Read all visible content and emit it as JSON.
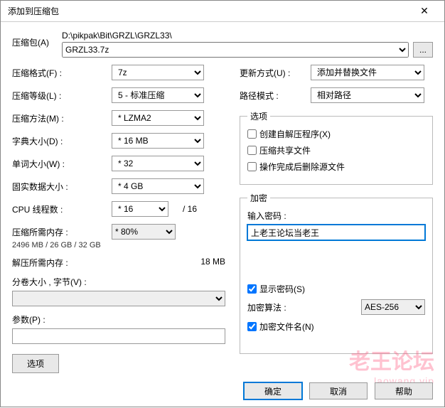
{
  "title": "添加到压缩包",
  "archive": {
    "label": "压缩包(A)",
    "path": "D:\\pikpak\\Bit\\GRZL\\GRZL33\\",
    "name": "GRZL33.7z",
    "browse": "..."
  },
  "left": {
    "format": {
      "label": "压缩格式(F) :",
      "value": "7z"
    },
    "level": {
      "label": "压缩等级(L) :",
      "value": "5 - 标准压缩"
    },
    "method": {
      "label": "压缩方法(M) :",
      "value": "* LZMA2"
    },
    "dict": {
      "label": "字典大小(D) :",
      "value": "* 16 MB"
    },
    "word": {
      "label": "单词大小(W) :",
      "value": "* 32"
    },
    "solid": {
      "label": "固实数据大小 :",
      "value": "* 4 GB"
    },
    "cpu": {
      "label": "CPU 线程数 :",
      "value": "* 16",
      "total": "/ 16"
    },
    "mem_compress": {
      "label": "压缩所需内存 :",
      "value": "* 80%",
      "detail": "2496 MB / 26 GB / 32 GB"
    },
    "mem_decomp": {
      "label": "解压所需内存 :",
      "value": "18 MB"
    },
    "volume": {
      "label": "分卷大小 , 字节(V) :",
      "value": ""
    },
    "params": {
      "label": "参数(P) :",
      "value": ""
    },
    "options_btn": "选项"
  },
  "right": {
    "update": {
      "label": "更新方式(U) :",
      "value": "添加并替换文件"
    },
    "pathmode": {
      "label": "路径模式 :",
      "value": "相对路径"
    },
    "options": {
      "legend": "选项",
      "sfx": "创建自解压程序(X)",
      "shared": "压缩共享文件",
      "delete": "操作完成后删除源文件"
    },
    "encryption": {
      "legend": "加密",
      "pw_label": "输入密码 :",
      "pw_value": "上老王论坛当老王",
      "show_pw": "显示密码(S)",
      "algo_label": "加密算法 :",
      "algo_value": "AES-256",
      "enc_names": "加密文件名(N)"
    }
  },
  "footer": {
    "ok": "确定",
    "cancel": "取消",
    "help": "帮助"
  },
  "watermark": {
    "line1": "老王论坛",
    "line2": "laowang.vip"
  }
}
